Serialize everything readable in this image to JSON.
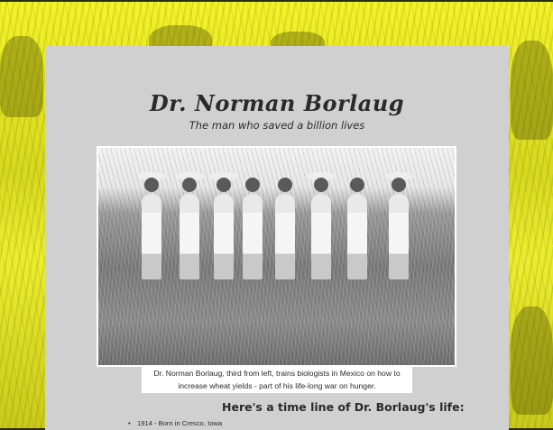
{
  "header": {
    "title": "Dr. Norman Borlaug",
    "subtitle": "The man who saved a billion lives"
  },
  "photo": {
    "caption": "Dr. Norman Borlaug, third from left, trains biologists in Mexico on how to increase wheat yields - part of his life-long war on hunger."
  },
  "timeline": {
    "heading": "Here's a time line of Dr. Borlaug's life:",
    "items": [
      "1914 - Born in Cresco, Iowa"
    ]
  },
  "colors": {
    "background": "#e8e84a",
    "panel": "#d0d0d0",
    "text": "#2a2a2a"
  }
}
